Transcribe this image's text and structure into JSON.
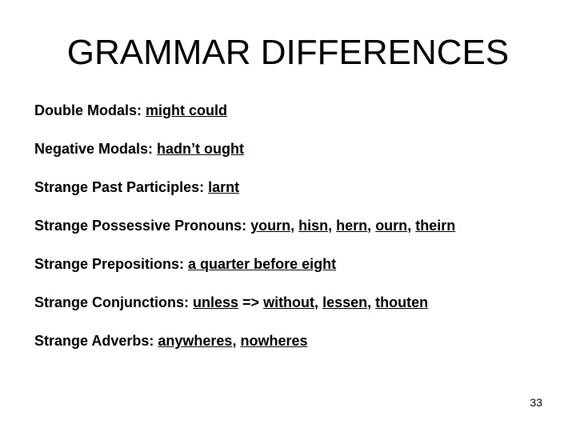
{
  "slide": {
    "title": "GRAMMAR DIFFERENCES",
    "page_number": "33",
    "items": [
      {
        "label": "Double Modals: ",
        "parts": [
          {
            "text": "might could",
            "u": true
          }
        ]
      },
      {
        "label": "Negative Modals: ",
        "parts": [
          {
            "text": "hadn’t ought",
            "u": true
          }
        ]
      },
      {
        "label": "Strange Past Participles: ",
        "parts": [
          {
            "text": "larnt",
            "u": true
          }
        ]
      },
      {
        "label": "Strange Possessive Pronouns: ",
        "parts": [
          {
            "text": "yourn",
            "u": true
          },
          {
            "text": ", ",
            "u": false
          },
          {
            "text": "hisn",
            "u": true
          },
          {
            "text": ", ",
            "u": false
          },
          {
            "text": "hern",
            "u": true
          },
          {
            "text": ", ",
            "u": false
          },
          {
            "text": "ourn",
            "u": true
          },
          {
            "text": ", ",
            "u": false
          },
          {
            "text": "theirn",
            "u": true
          }
        ]
      },
      {
        "label": "Strange Prepositions: ",
        "parts": [
          {
            "text": "a quarter before eight",
            "u": true
          }
        ]
      },
      {
        "label": "Strange Conjunctions: ",
        "parts": [
          {
            "text": "unless",
            "u": true
          },
          {
            "text": " => ",
            "u": false
          },
          {
            "text": "without",
            "u": true
          },
          {
            "text": ", ",
            "u": false
          },
          {
            "text": "lessen",
            "u": true
          },
          {
            "text": ", ",
            "u": false
          },
          {
            "text": "thouten",
            "u": true
          }
        ]
      },
      {
        "label": "Strange Adverbs: ",
        "parts": [
          {
            "text": "anywheres",
            "u": true
          },
          {
            "text": ", ",
            "u": false
          },
          {
            "text": "nowheres",
            "u": true
          }
        ]
      }
    ]
  }
}
